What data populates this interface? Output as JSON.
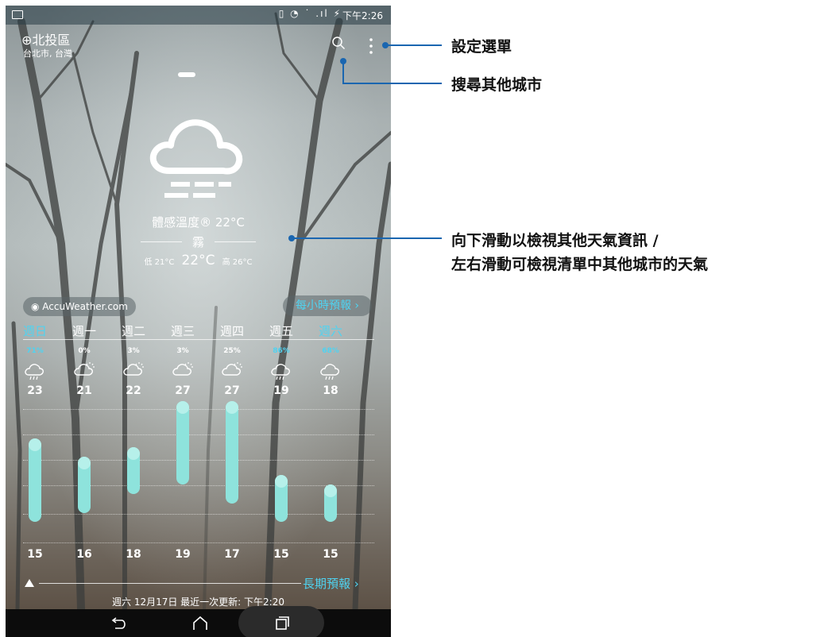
{
  "status": {
    "time": "下午2:26",
    "icons": "▯ ◔ ˙ .ıl ⚡"
  },
  "location": {
    "name": "北投區",
    "sub": "台北市, 台灣",
    "pin": "⊕"
  },
  "current": {
    "feels_like": "體感溫度® 22°C",
    "condition": "霧",
    "low": "低 21°C",
    "now": "22°C",
    "high": "高 26°C"
  },
  "provider": "◉ AccuWeather.com",
  "hourly_label": "每小時預報 ›",
  "forecast": [
    {
      "day": "週日",
      "pct": "71%",
      "hi": "23",
      "lo": "15",
      "icon": "rain-cloud-icon",
      "active": true
    },
    {
      "day": "週一",
      "pct": "0%",
      "hi": "21",
      "lo": "16",
      "icon": "partly-cloudy-icon"
    },
    {
      "day": "週二",
      "pct": "3%",
      "hi": "22",
      "lo": "18",
      "icon": "partly-cloudy-icon"
    },
    {
      "day": "週三",
      "pct": "3%",
      "hi": "27",
      "lo": "19",
      "icon": "partly-cloudy-icon"
    },
    {
      "day": "週四",
      "pct": "25%",
      "hi": "27",
      "lo": "17",
      "icon": "partly-cloudy-icon"
    },
    {
      "day": "週五",
      "pct": "86%",
      "hi": "19",
      "lo": "15",
      "icon": "rain-cloud-icon"
    },
    {
      "day": "週六",
      "pct": "68%",
      "hi": "18",
      "lo": "15",
      "icon": "rain-cloud-icon",
      "active": true
    }
  ],
  "long_label": "長期預報 ›",
  "updated": "週六 12月17日 最近一次更新: 下午2:20",
  "callouts": {
    "menu": "設定選單",
    "search": "搜尋其他城市",
    "swipe_line1": "向下滑動以檢視其他天氣資訊 /",
    "swipe_line2": "左右滑動可檢視清單中其他城市的天氣"
  },
  "colors": {
    "accent": "#4fd3f1",
    "bar": "#8ee3dc"
  }
}
